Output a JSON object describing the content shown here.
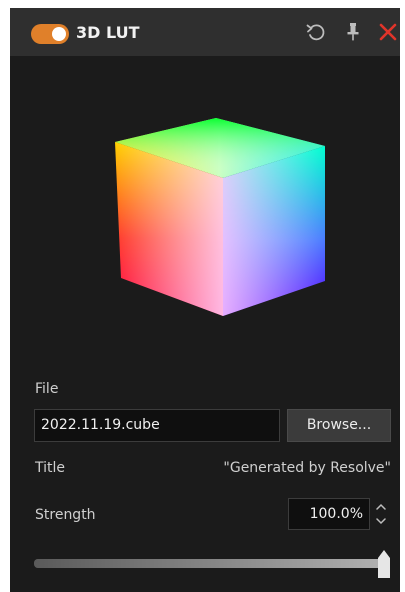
{
  "header": {
    "title": "3D LUT",
    "toggle_on": true,
    "accent_color": "#e0802a",
    "close_color": "#e0342a",
    "icons": [
      "reset-icon",
      "pin-icon",
      "close-icon"
    ]
  },
  "preview": {
    "icon": "color-cube"
  },
  "file": {
    "label": "File",
    "value": "2022.11.19.cube",
    "browse_label": "Browse..."
  },
  "title_row": {
    "label": "Title",
    "value": "\"Generated by Resolve\""
  },
  "strength": {
    "label": "Strength",
    "value_text": "100.0%",
    "value": 100.0,
    "min": 0,
    "max": 100
  }
}
